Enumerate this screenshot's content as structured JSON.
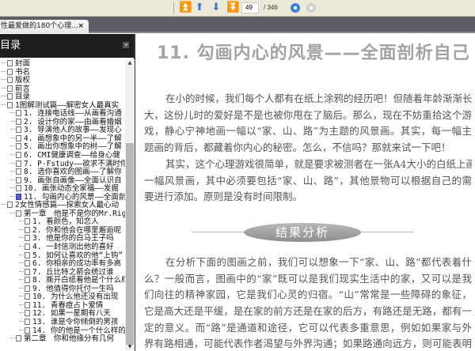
{
  "toolbar": {
    "page_current": "49",
    "page_total": "/ 346",
    "buttons": [
      "first-page",
      "previous-page",
      "next-page",
      "last-page",
      "go-back",
      "go-forward"
    ]
  },
  "tab": {
    "title": "性最爱做的180个心理...",
    "close": "×"
  },
  "sidebar": {
    "title": "目录",
    "collapse": "◂",
    "items": [
      {
        "label": "封面",
        "level": 0
      },
      {
        "label": "书名",
        "level": 0
      },
      {
        "label": "版权",
        "level": 0
      },
      {
        "label": "前言",
        "level": 0
      },
      {
        "label": "目录",
        "level": 0
      },
      {
        "label": "1图解测试篇——解密女人最真实",
        "level": 0
      },
      {
        "label": "1. 连接电话线——从画看沟通",
        "level": 1
      },
      {
        "label": "2. 设计你的家——由画看婚姻",
        "level": 1
      },
      {
        "label": "3. 导演他人的故事——发现心",
        "level": 1
      },
      {
        "label": "4. 画想象中的另一半——了解",
        "level": 1
      },
      {
        "label": "5. 画出你想象中的树——了解",
        "level": 1
      },
      {
        "label": "6. CMI健康调查——给身心健",
        "level": 1
      },
      {
        "label": "7. P-Fstudy——欲求不满时你",
        "level": 1
      },
      {
        "label": "8. 选你喜欢的图画——了解你",
        "level": 1
      },
      {
        "label": "9. 画张自画像——全面认识自",
        "level": 1
      },
      {
        "label": "10. 画张动态全家福——发掘",
        "level": 1
      },
      {
        "label": "11. 勾画内心的风景——全面剖",
        "level": 1,
        "selected": true
      },
      {
        "label": "2女性情感篇——探索女人最心动",
        "level": 0
      },
      {
        "label": "第一章　他是不是你的Mr.Right",
        "level": 1
      },
      {
        "label": "1. 看颜色，知恋人",
        "level": 2
      },
      {
        "label": "2. 你和他会在哪里邂逅呢",
        "level": 2
      },
      {
        "label": "3. 他是你的白马王子吗",
        "level": 2
      },
      {
        "label": "4. 一封信测出他的喜好",
        "level": 2
      },
      {
        "label": "5. 如何让喜欢的他“上钩”",
        "level": 2
      },
      {
        "label": "6. 你相亲的成功率有多高",
        "level": 2
      },
      {
        "label": "7. 丘比特之箭会统过谁",
        "level": 2
      },
      {
        "label": "8. 撕开白纸看他是个什么样",
        "level": 2
      },
      {
        "label": "9. 他值得你托付一生吗",
        "level": 2
      },
      {
        "label": "10. 为什么他还没有出现",
        "level": 2
      },
      {
        "label": "11. 青春痘占卜爱情",
        "level": 2
      },
      {
        "label": "12. 如果一星期有八天",
        "level": 2
      },
      {
        "label": "13. 谁是令你倾倒的男孩",
        "level": 2
      },
      {
        "label": "14. 你的他是一个什么样的",
        "level": 2
      },
      {
        "label": "第二章　你和他缘分有几何",
        "level": 1
      }
    ]
  },
  "document": {
    "title": "11.  勾画内心的风景——全面剖析自己",
    "para1": [
      "在小的时候，我们每个人都有在纸上涂鸦的经历吧！但随着年龄渐渐长",
      "大，这份儿时的爱好是不是也被你甩在了脑后。那么，现在不妨重拾这个游",
      "戏，静心宁神地画一幅以“家、山、路”为主题的风景画。其实，每一幅主",
      "题画的背后，都藏着你内心的秘密。怎么，不信吗？那就来试一下吧！"
    ],
    "para2": [
      "其实，这个心理游戏很简单，就是要求被测者在一张A4大小的白纸上画",
      "一幅风景画，其中必须要包括“家、山、路”，其他景物可以根据自己的需",
      "要进行添加。原则是没有时间限制。"
    ],
    "section_heading": "结果分析",
    "para3": [
      "在分析下面的图画之前，我们可以想象一下“家、山、路”都代表着什",
      "么？一般而言，图画中的“家”既可以是我们现实生活中的家，又可以是我",
      "们向往的精神家园，它是我们心灵的归宿。“山”常常是一些障碍的象征，",
      "它是高大还是平缓，是在家的前方还是在家的后方，有路还是无路，都有一",
      "定的意义。而“路”是通道和途径，它可以代表多重意思，例如如果家与外",
      "界有路相通，可能代表作者渴望与外界沟通；如果路通向远方，则可能表明"
    ]
  }
}
